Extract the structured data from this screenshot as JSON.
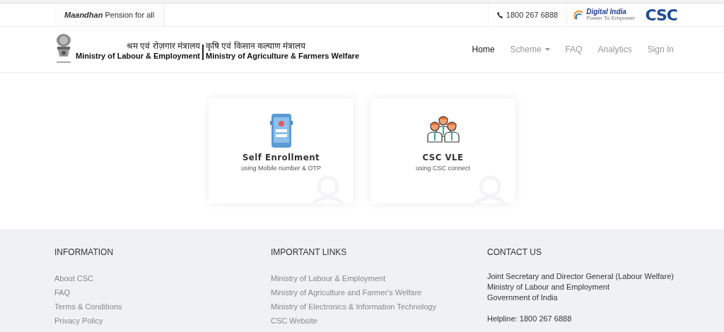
{
  "topbar": {
    "tagline": "**Maandhan** Pension for all",
    "phone": "1800 267 6888",
    "digital_india": {
      "title": "Digital India",
      "subtitle": "Power To Empower"
    },
    "csc_logo": "CSC"
  },
  "header": {
    "ministries": [
      {
        "hindi": "श्रम एवं रोज़गार मंत्रालय",
        "english": "Ministry of Labour & Employment"
      },
      {
        "hindi": "कृषि एवं किसान कल्याण मंत्रालय",
        "english": "Ministry of Agriculture & Farmers Welfare"
      }
    ],
    "nav": [
      {
        "label": "Home",
        "selected": true,
        "dropdown": false
      },
      {
        "label": "Scheme",
        "selected": false,
        "dropdown": true
      },
      {
        "label": "FAQ",
        "selected": false,
        "dropdown": false
      },
      {
        "label": "Analytics",
        "selected": false,
        "dropdown": false
      },
      {
        "label": "Sign In",
        "selected": false,
        "dropdown": false
      }
    ]
  },
  "cards": [
    {
      "kind": "phone",
      "title": "Self Enrollment",
      "subtitle": "using Mobile number & OTP"
    },
    {
      "kind": "group",
      "title": "CSC VLE",
      "subtitle": "using CSC connect"
    }
  ],
  "footer": {
    "columns": [
      {
        "heading": "INFORMATION",
        "kind": "links",
        "lines": [
          "About CSC",
          "FAQ",
          "Terms & Conditions",
          "Privacy Policy"
        ]
      },
      {
        "heading": "IMPORTANT LINKS",
        "kind": "links",
        "lines": [
          "Ministry of Labour & Employment",
          "Ministry of Agriculture and Farmer's Welfare",
          "Ministry of Electronics & Information Technology",
          "CSC Website"
        ]
      },
      {
        "heading": "CONTACT US",
        "kind": "text",
        "lines": [
          "Joint Secretary and Director General (Labour Welfare)",
          "Ministry of Labour and Employment",
          "Government of India"
        ],
        "helpline": "Helpline: 1800 267 6888"
      }
    ]
  }
}
